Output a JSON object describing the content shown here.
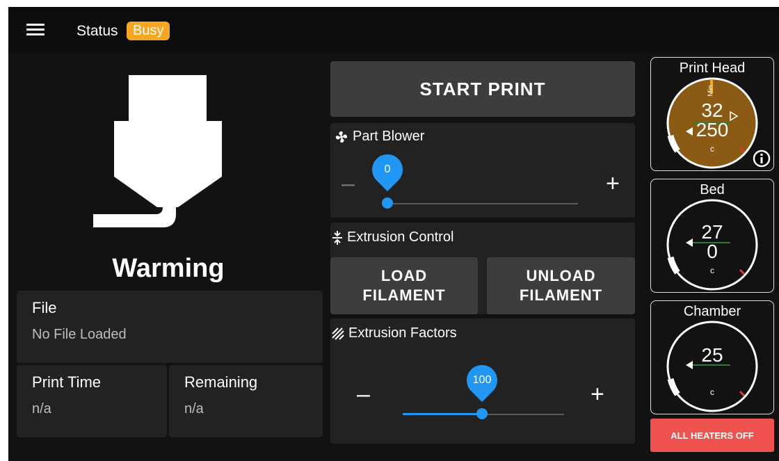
{
  "header": {
    "status_label": "Status",
    "status_value": "Busy",
    "status_color": "#f5a623"
  },
  "job": {
    "state": "Warming",
    "file_label": "File",
    "file_value": "No File Loaded",
    "print_time_label": "Print Time",
    "print_time_value": "n/a",
    "remaining_label": "Remaining",
    "remaining_value": "n/a"
  },
  "controls": {
    "start_print": "START PRINT",
    "part_blower": {
      "title": "Part Blower",
      "value": "0",
      "minus": "–",
      "plus": "+"
    },
    "extrusion_control": {
      "title": "Extrusion Control",
      "load": [
        "LOAD",
        "FILAMENT"
      ],
      "unload": [
        "UNLOAD",
        "FILAMENT"
      ]
    },
    "extrusion_factors": {
      "title": "Extrusion Factors",
      "value": "100",
      "minus": "–",
      "plus": "+"
    }
  },
  "heaters": {
    "print_head": {
      "title": "Print Head",
      "current": "32",
      "target": "250",
      "unit": "c",
      "label": "Min",
      "accent": "#8b5a14"
    },
    "bed": {
      "title": "Bed",
      "current": "27",
      "target": "0",
      "unit": "c"
    },
    "chamber": {
      "title": "Chamber",
      "current": "25",
      "unit": "c"
    },
    "all_off": "ALL HEATERS OFF"
  },
  "colors": {
    "primary": "#2196f3",
    "danger": "#ef5350",
    "marker": "#2e7d32"
  }
}
